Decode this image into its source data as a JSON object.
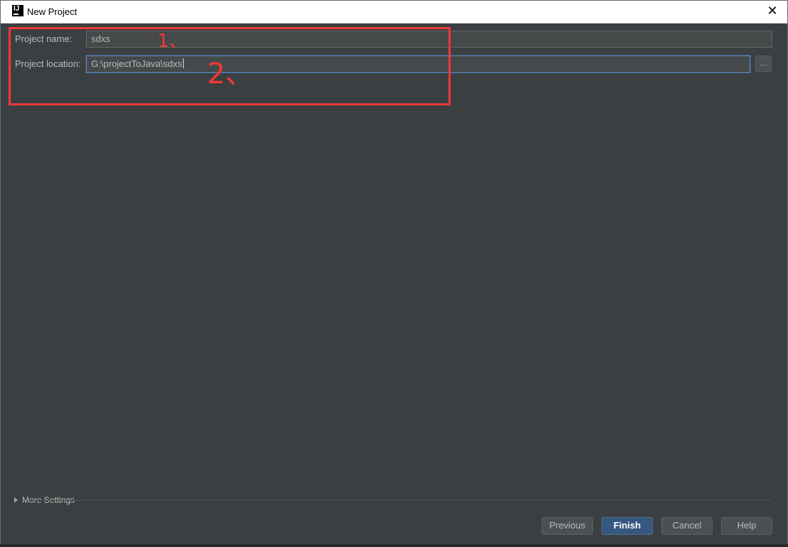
{
  "window": {
    "title": "New Project",
    "icon_label": "IJ",
    "close_glyph": "✕"
  },
  "form": {
    "project_name_label": "Project name:",
    "project_name_value": "sdxs",
    "project_location_label": "Project location:",
    "project_location_value": "G:\\projectToJava\\sdxs",
    "browse_label": "..."
  },
  "annotations": {
    "mark1": "1、",
    "mark2": "2、",
    "color": "#f03838"
  },
  "more_settings": {
    "label": "More Settings"
  },
  "buttons": {
    "previous": "Previous",
    "finish": "Finish",
    "cancel": "Cancel",
    "help": "Help"
  },
  "colors": {
    "background": "#3c3f41",
    "text": "#bbbbbb",
    "default_button": "#365880",
    "focus_border": "#5d80ad"
  }
}
